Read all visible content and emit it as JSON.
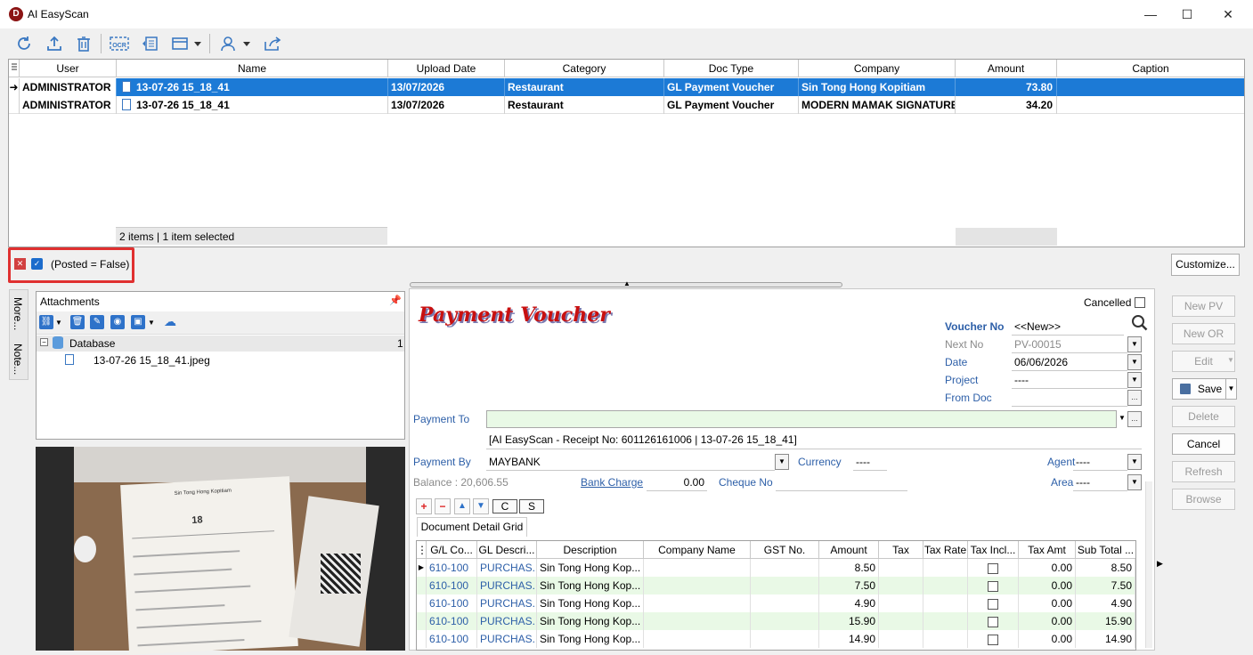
{
  "window": {
    "title": "AI EasyScan",
    "minimize": "—",
    "maximize": "☐",
    "close": "✕"
  },
  "toolbar": {
    "icons": [
      "refresh-icon",
      "upload-icon",
      "delete-icon",
      "ocr-icon",
      "indent-icon",
      "layout-icon",
      "user-icon",
      "share-icon"
    ]
  },
  "grid": {
    "columns": [
      "User",
      "Name",
      "Upload Date",
      "Category",
      "Doc Type",
      "Company",
      "Amount",
      "Caption"
    ],
    "rows": [
      {
        "user": "ADMINISTRATOR",
        "name": "13-07-26 15_18_41",
        "upload_date": "13/07/2026",
        "category": "Restaurant",
        "doc_type": "GL Payment Voucher",
        "company": "Sin Tong Hong Kopitiam",
        "amount": "73.80",
        "caption": ""
      },
      {
        "user": "ADMINISTRATOR",
        "name": "13-07-26 15_18_41",
        "upload_date": "13/07/2026",
        "category": "Restaurant",
        "doc_type": "GL Payment Voucher",
        "company": "MODERN MAMAK SIGNATURE",
        "amount": "34.20",
        "caption": ""
      }
    ],
    "status": "2 items |  1 item selected"
  },
  "filter": {
    "text": "(Posted = False)",
    "customize": "Customize..."
  },
  "side_tabs": {
    "more": "More...",
    "note": "Note..."
  },
  "attachments": {
    "title": "Attachments",
    "root": "Database",
    "root_count": "1",
    "file": "13-07-26 15_18_41.jpeg"
  },
  "receipt": {
    "shop": "Sin Tong Hong Kopitiam",
    "table": "18"
  },
  "pv": {
    "title": "Payment Voucher",
    "cancelled": "Cancelled",
    "voucher_no_label": "Voucher No",
    "voucher_no": "<<New>>",
    "next_no_label": "Next No",
    "next_no": "PV-00015",
    "date_label": "Date",
    "date": "06/06/2026",
    "project_label": "Project",
    "project": "----",
    "from_doc_label": "From Doc",
    "from_doc": "",
    "payment_to_label": "Payment To",
    "payment_to": "",
    "description": "[AI EasyScan - Receipt No: 601126161006 | 13-07-26 15_18_41]",
    "payment_by_label": "Payment By",
    "payment_by": "MAYBANK",
    "currency_label": "Currency",
    "currency": "----",
    "agent_label": "Agent",
    "agent": "----",
    "balance": "Balance : 20,606.55",
    "bank_charge_label": "Bank Charge",
    "bank_charge": "0.00",
    "cheque_no_label": "Cheque No",
    "cheque_no": "",
    "area_label": "Area",
    "area": "----",
    "btn_c": "C",
    "btn_s": "S",
    "detail_tab": "Document Detail Grid"
  },
  "detail": {
    "columns": [
      "G/L Co...",
      "GL Descri...",
      "Description",
      "Company Name",
      "GST No.",
      "Amount",
      "Tax",
      "Tax Rate",
      "Tax Incl...",
      "Tax Amt",
      "Sub Total ..."
    ],
    "rows": [
      {
        "gl": "610-100",
        "gld": "PURCHAS...",
        "desc": "Sin Tong Hong Kop...",
        "company": "",
        "gst": "",
        "amount": "8.50",
        "tax": "",
        "rate": "",
        "taxamt": "0.00",
        "sub": "8.50"
      },
      {
        "gl": "610-100",
        "gld": "PURCHAS...",
        "desc": "Sin Tong Hong Kop...",
        "company": "",
        "gst": "",
        "amount": "7.50",
        "tax": "",
        "rate": "",
        "taxamt": "0.00",
        "sub": "7.50"
      },
      {
        "gl": "610-100",
        "gld": "PURCHAS...",
        "desc": "Sin Tong Hong Kop...",
        "company": "",
        "gst": "",
        "amount": "4.90",
        "tax": "",
        "rate": "",
        "taxamt": "0.00",
        "sub": "4.90"
      },
      {
        "gl": "610-100",
        "gld": "PURCHAS...",
        "desc": "Sin Tong Hong Kop...",
        "company": "",
        "gst": "",
        "amount": "15.90",
        "tax": "",
        "rate": "",
        "taxamt": "0.00",
        "sub": "15.90"
      },
      {
        "gl": "610-100",
        "gld": "PURCHAS...",
        "desc": "Sin Tong Hong Kop...",
        "company": "",
        "gst": "",
        "amount": "14.90",
        "tax": "",
        "rate": "",
        "taxamt": "0.00",
        "sub": "14.90"
      }
    ]
  },
  "actions": {
    "new_pv": "New PV",
    "new_or": "New OR",
    "edit": "Edit",
    "save": "Save",
    "delete": "Delete",
    "cancel": "Cancel",
    "refresh": "Refresh",
    "browse": "Browse"
  },
  "colors": {
    "selection": "#1c7ad6",
    "accent_red": "#e03030",
    "link_blue": "#2d5fa8",
    "input_green": "#e9f9e6"
  }
}
